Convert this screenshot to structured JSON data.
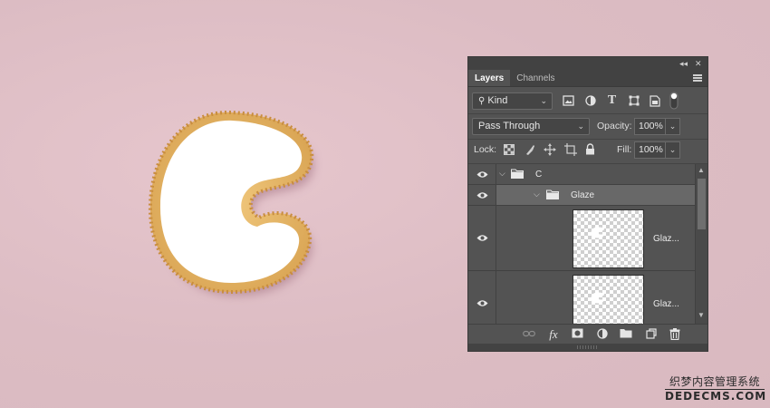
{
  "panel": {
    "tabs": [
      {
        "label": "Layers",
        "active": true
      },
      {
        "label": "Channels",
        "active": false
      }
    ],
    "filter": {
      "kind_label": "Kind",
      "icons": [
        "image-filter-icon",
        "adjustment-filter-icon",
        "type-filter-icon",
        "shape-filter-icon",
        "smart-object-filter-icon",
        "filter-toggle-icon"
      ]
    },
    "blend_mode": "Pass Through",
    "opacity_label": "Opacity:",
    "opacity_value": "100%",
    "lock_label": "Lock:",
    "lock_icons": [
      "lock-transparent-icon",
      "lock-image-icon",
      "lock-position-icon",
      "lock-artboard-icon",
      "lock-all-icon"
    ],
    "fill_label": "Fill:",
    "fill_value": "100%",
    "layers": [
      {
        "name": "C",
        "type": "group",
        "expanded": true,
        "visible": true,
        "selected": false
      },
      {
        "name": "Glaze",
        "type": "group",
        "expanded": true,
        "visible": true,
        "selected": true
      },
      {
        "name": "Glaz...",
        "type": "layer",
        "visible": true,
        "selected": false
      },
      {
        "name": "Glaz...",
        "type": "layer",
        "visible": true,
        "selected": false
      }
    ],
    "bottom_icons": [
      "link-layers-icon",
      "fx-icon",
      "layer-mask-icon",
      "adjustment-layer-icon",
      "new-group-icon",
      "new-layer-icon",
      "delete-icon"
    ],
    "fx_label": "fx"
  },
  "colors": {
    "background": "#dcbcc3",
    "panel": "#535353",
    "selected_row": "#686868",
    "cookie_crust": "#e2b264",
    "glaze": "#ffffff"
  },
  "watermark": {
    "cn": "织梦内容管理系统",
    "en": "DEDECMS.COM"
  }
}
